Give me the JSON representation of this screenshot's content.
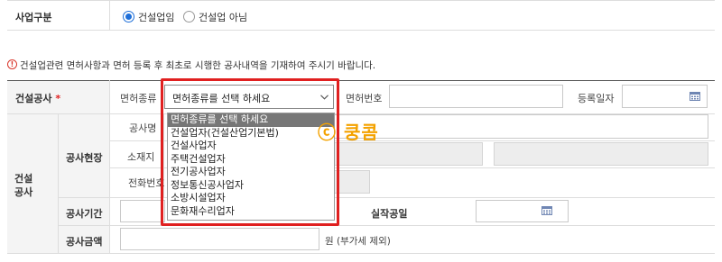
{
  "business_type": {
    "label": "사업구분",
    "options": [
      {
        "label": "건설업임",
        "selected": true
      },
      {
        "label": "건설업 아님",
        "selected": false
      }
    ]
  },
  "notice": {
    "icon": "!",
    "text": "건설업관련 면허사항과 면허 등록 후 최초로 시행한 공사내역을 기재하여 주시기 바랍니다."
  },
  "construction": {
    "label": "건설공사",
    "required_mark": "*",
    "license_type_label": "면허종류",
    "license_select_value": "면허종류를 선택 하세요",
    "license_number_label": "면허번호",
    "reg_date_label": "등록일자",
    "group_label_line1": "건설",
    "group_label_line2": "공사",
    "site_label": "공사현장",
    "site_name_label": "공사명",
    "site_address_label": "소재지",
    "site_phone_label": "전화번호",
    "period_label": "공사기간",
    "completion_label": "실작공일",
    "amount_label": "공사금액",
    "amount_unit": "원 (부가세 제외)"
  },
  "dropdown": {
    "options": [
      "면허종류를 선택 하세요",
      "건설업자(건설산업기본법)",
      "건설사업자",
      "주택건설업자",
      "전기공사업자",
      "정보통신공사업자",
      "소방시설업자",
      "문화재수리업자"
    ]
  },
  "watermark": "ⓒ 쿵콤",
  "colors": {
    "accent_blue": "#1e6fd9",
    "highlight_red": "#e02020",
    "notice_red": "#d9362b",
    "label_bg": "#f4f4f4",
    "watermark_orange": "#f4a200",
    "selected_option_bg": "#777777"
  }
}
